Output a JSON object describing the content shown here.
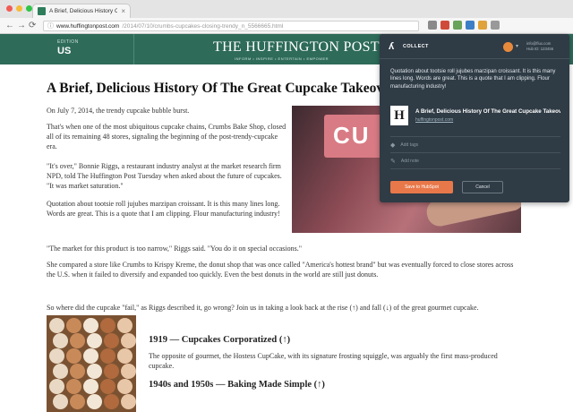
{
  "browser": {
    "tab_title": "A Brief, Delicious History Of T",
    "tab_close": "×",
    "url_host": "www.huffingtonpost.com",
    "url_path": "/2014/07/10/crumbs-cupcakes-closing-trendy_n_5566665.html",
    "back": "←",
    "forward": "→",
    "reload": "⟳",
    "ext_colors": [
      "#8a8a8a",
      "#d04a3a",
      "#6aa35a",
      "#3d7fc6",
      "#e0a23a",
      "#999999"
    ]
  },
  "site": {
    "edition_label": "EDITION",
    "edition_value": "US",
    "logo": "THE HUFFINGTON POST",
    "tagline": "INFORM • INSPIRE • ENTERTAIN • EMPOWER"
  },
  "article": {
    "headline": "A Brief, Delicious History Of The Great Cupcake Takeover",
    "p1": "On July 7, 2014, the trendy cupcake bubble burst.",
    "p2": "That's when one of the most ubiquitous cupcake chains, Crumbs Bake Shop, closed all of its remaining 48 stores, signaling the beginning of the post-trendy-cupcake era.",
    "p3": "\"It's over,\" Bonnie Riggs, a restaurant industry analyst at the market research firm NPD, told The Huffington Post Tuesday when asked about the future of cupcakes. \"It was market saturation.\"",
    "p4": "Quotation about tootsie roll jujubes marzipan croissant. It is this many lines long. Words are great. This is a quote that I am clipping. Flour manufacturing industry!",
    "p5": "\"The market for this product is too narrow,\" Riggs said. \"You do it on special occasions.\"",
    "p6": "She compared a store like Crumbs to Krispy Kreme, the donut shop that was once called \"America's hottest brand\" but was eventually forced to close stores across the U.S. when it failed to diversify and expanded too quickly. Even the best donuts in the world are still just donuts.",
    "p7": "So where did the cupcake \"fail,\" as Riggs described it, go wrong? Join us in taking a look back at the rise (↑) and fall (↓) of the great gourmet cupcake.",
    "h1": "1919 — Cupcakes Corporatized (↑)",
    "p8": "The opposite of gourmet, the Hostess CupCake, with its signature frosting squiggle, was arguably the first mass-produced cupcake.",
    "h2": "1940s and 1950s — Baking Made Simple (↑)",
    "photo_sign": "CU"
  },
  "collect": {
    "brand_icon": "ʎ",
    "brand_label": "COLLECT",
    "account_email": "info@flux.com",
    "account_sub": "Hub ID: 123456",
    "caret": "▾",
    "quote": "Quotation about tootsie roll jujubes marzipan croissant. It is this many lines long. Words are great. This is a quote that I am clipping. Flour manufacturing industry!",
    "link_thumb": "H",
    "link_title": "A Brief, Delicious History Of The Great Cupcake Takeover",
    "link_host": "huffingtonpost.com",
    "tags_placeholder": "Add tags",
    "tags_icon": "◆",
    "note_placeholder": "Add note",
    "note_icon": "✎",
    "save_label": "Save to HubSpot",
    "cancel_label": "Cancel"
  }
}
